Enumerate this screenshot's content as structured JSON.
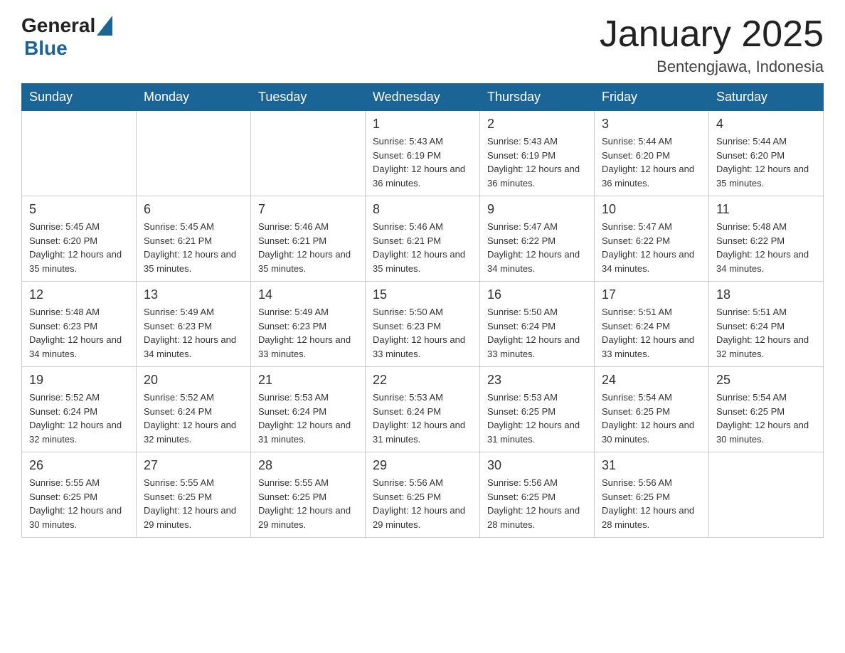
{
  "header": {
    "title": "January 2025",
    "subtitle": "Bentengjawa, Indonesia",
    "logo_general": "General",
    "logo_blue": "Blue"
  },
  "weekdays": [
    "Sunday",
    "Monday",
    "Tuesday",
    "Wednesday",
    "Thursday",
    "Friday",
    "Saturday"
  ],
  "weeks": [
    [
      {
        "day": "",
        "info": ""
      },
      {
        "day": "",
        "info": ""
      },
      {
        "day": "",
        "info": ""
      },
      {
        "day": "1",
        "info": "Sunrise: 5:43 AM\nSunset: 6:19 PM\nDaylight: 12 hours\nand 36 minutes."
      },
      {
        "day": "2",
        "info": "Sunrise: 5:43 AM\nSunset: 6:19 PM\nDaylight: 12 hours\nand 36 minutes."
      },
      {
        "day": "3",
        "info": "Sunrise: 5:44 AM\nSunset: 6:20 PM\nDaylight: 12 hours\nand 36 minutes."
      },
      {
        "day": "4",
        "info": "Sunrise: 5:44 AM\nSunset: 6:20 PM\nDaylight: 12 hours\nand 35 minutes."
      }
    ],
    [
      {
        "day": "5",
        "info": "Sunrise: 5:45 AM\nSunset: 6:20 PM\nDaylight: 12 hours\nand 35 minutes."
      },
      {
        "day": "6",
        "info": "Sunrise: 5:45 AM\nSunset: 6:21 PM\nDaylight: 12 hours\nand 35 minutes."
      },
      {
        "day": "7",
        "info": "Sunrise: 5:46 AM\nSunset: 6:21 PM\nDaylight: 12 hours\nand 35 minutes."
      },
      {
        "day": "8",
        "info": "Sunrise: 5:46 AM\nSunset: 6:21 PM\nDaylight: 12 hours\nand 35 minutes."
      },
      {
        "day": "9",
        "info": "Sunrise: 5:47 AM\nSunset: 6:22 PM\nDaylight: 12 hours\nand 34 minutes."
      },
      {
        "day": "10",
        "info": "Sunrise: 5:47 AM\nSunset: 6:22 PM\nDaylight: 12 hours\nand 34 minutes."
      },
      {
        "day": "11",
        "info": "Sunrise: 5:48 AM\nSunset: 6:22 PM\nDaylight: 12 hours\nand 34 minutes."
      }
    ],
    [
      {
        "day": "12",
        "info": "Sunrise: 5:48 AM\nSunset: 6:23 PM\nDaylight: 12 hours\nand 34 minutes."
      },
      {
        "day": "13",
        "info": "Sunrise: 5:49 AM\nSunset: 6:23 PM\nDaylight: 12 hours\nand 34 minutes."
      },
      {
        "day": "14",
        "info": "Sunrise: 5:49 AM\nSunset: 6:23 PM\nDaylight: 12 hours\nand 33 minutes."
      },
      {
        "day": "15",
        "info": "Sunrise: 5:50 AM\nSunset: 6:23 PM\nDaylight: 12 hours\nand 33 minutes."
      },
      {
        "day": "16",
        "info": "Sunrise: 5:50 AM\nSunset: 6:24 PM\nDaylight: 12 hours\nand 33 minutes."
      },
      {
        "day": "17",
        "info": "Sunrise: 5:51 AM\nSunset: 6:24 PM\nDaylight: 12 hours\nand 33 minutes."
      },
      {
        "day": "18",
        "info": "Sunrise: 5:51 AM\nSunset: 6:24 PM\nDaylight: 12 hours\nand 32 minutes."
      }
    ],
    [
      {
        "day": "19",
        "info": "Sunrise: 5:52 AM\nSunset: 6:24 PM\nDaylight: 12 hours\nand 32 minutes."
      },
      {
        "day": "20",
        "info": "Sunrise: 5:52 AM\nSunset: 6:24 PM\nDaylight: 12 hours\nand 32 minutes."
      },
      {
        "day": "21",
        "info": "Sunrise: 5:53 AM\nSunset: 6:24 PM\nDaylight: 12 hours\nand 31 minutes."
      },
      {
        "day": "22",
        "info": "Sunrise: 5:53 AM\nSunset: 6:24 PM\nDaylight: 12 hours\nand 31 minutes."
      },
      {
        "day": "23",
        "info": "Sunrise: 5:53 AM\nSunset: 6:25 PM\nDaylight: 12 hours\nand 31 minutes."
      },
      {
        "day": "24",
        "info": "Sunrise: 5:54 AM\nSunset: 6:25 PM\nDaylight: 12 hours\nand 30 minutes."
      },
      {
        "day": "25",
        "info": "Sunrise: 5:54 AM\nSunset: 6:25 PM\nDaylight: 12 hours\nand 30 minutes."
      }
    ],
    [
      {
        "day": "26",
        "info": "Sunrise: 5:55 AM\nSunset: 6:25 PM\nDaylight: 12 hours\nand 30 minutes."
      },
      {
        "day": "27",
        "info": "Sunrise: 5:55 AM\nSunset: 6:25 PM\nDaylight: 12 hours\nand 29 minutes."
      },
      {
        "day": "28",
        "info": "Sunrise: 5:55 AM\nSunset: 6:25 PM\nDaylight: 12 hours\nand 29 minutes."
      },
      {
        "day": "29",
        "info": "Sunrise: 5:56 AM\nSunset: 6:25 PM\nDaylight: 12 hours\nand 29 minutes."
      },
      {
        "day": "30",
        "info": "Sunrise: 5:56 AM\nSunset: 6:25 PM\nDaylight: 12 hours\nand 28 minutes."
      },
      {
        "day": "31",
        "info": "Sunrise: 5:56 AM\nSunset: 6:25 PM\nDaylight: 12 hours\nand 28 minutes."
      },
      {
        "day": "",
        "info": ""
      }
    ]
  ]
}
